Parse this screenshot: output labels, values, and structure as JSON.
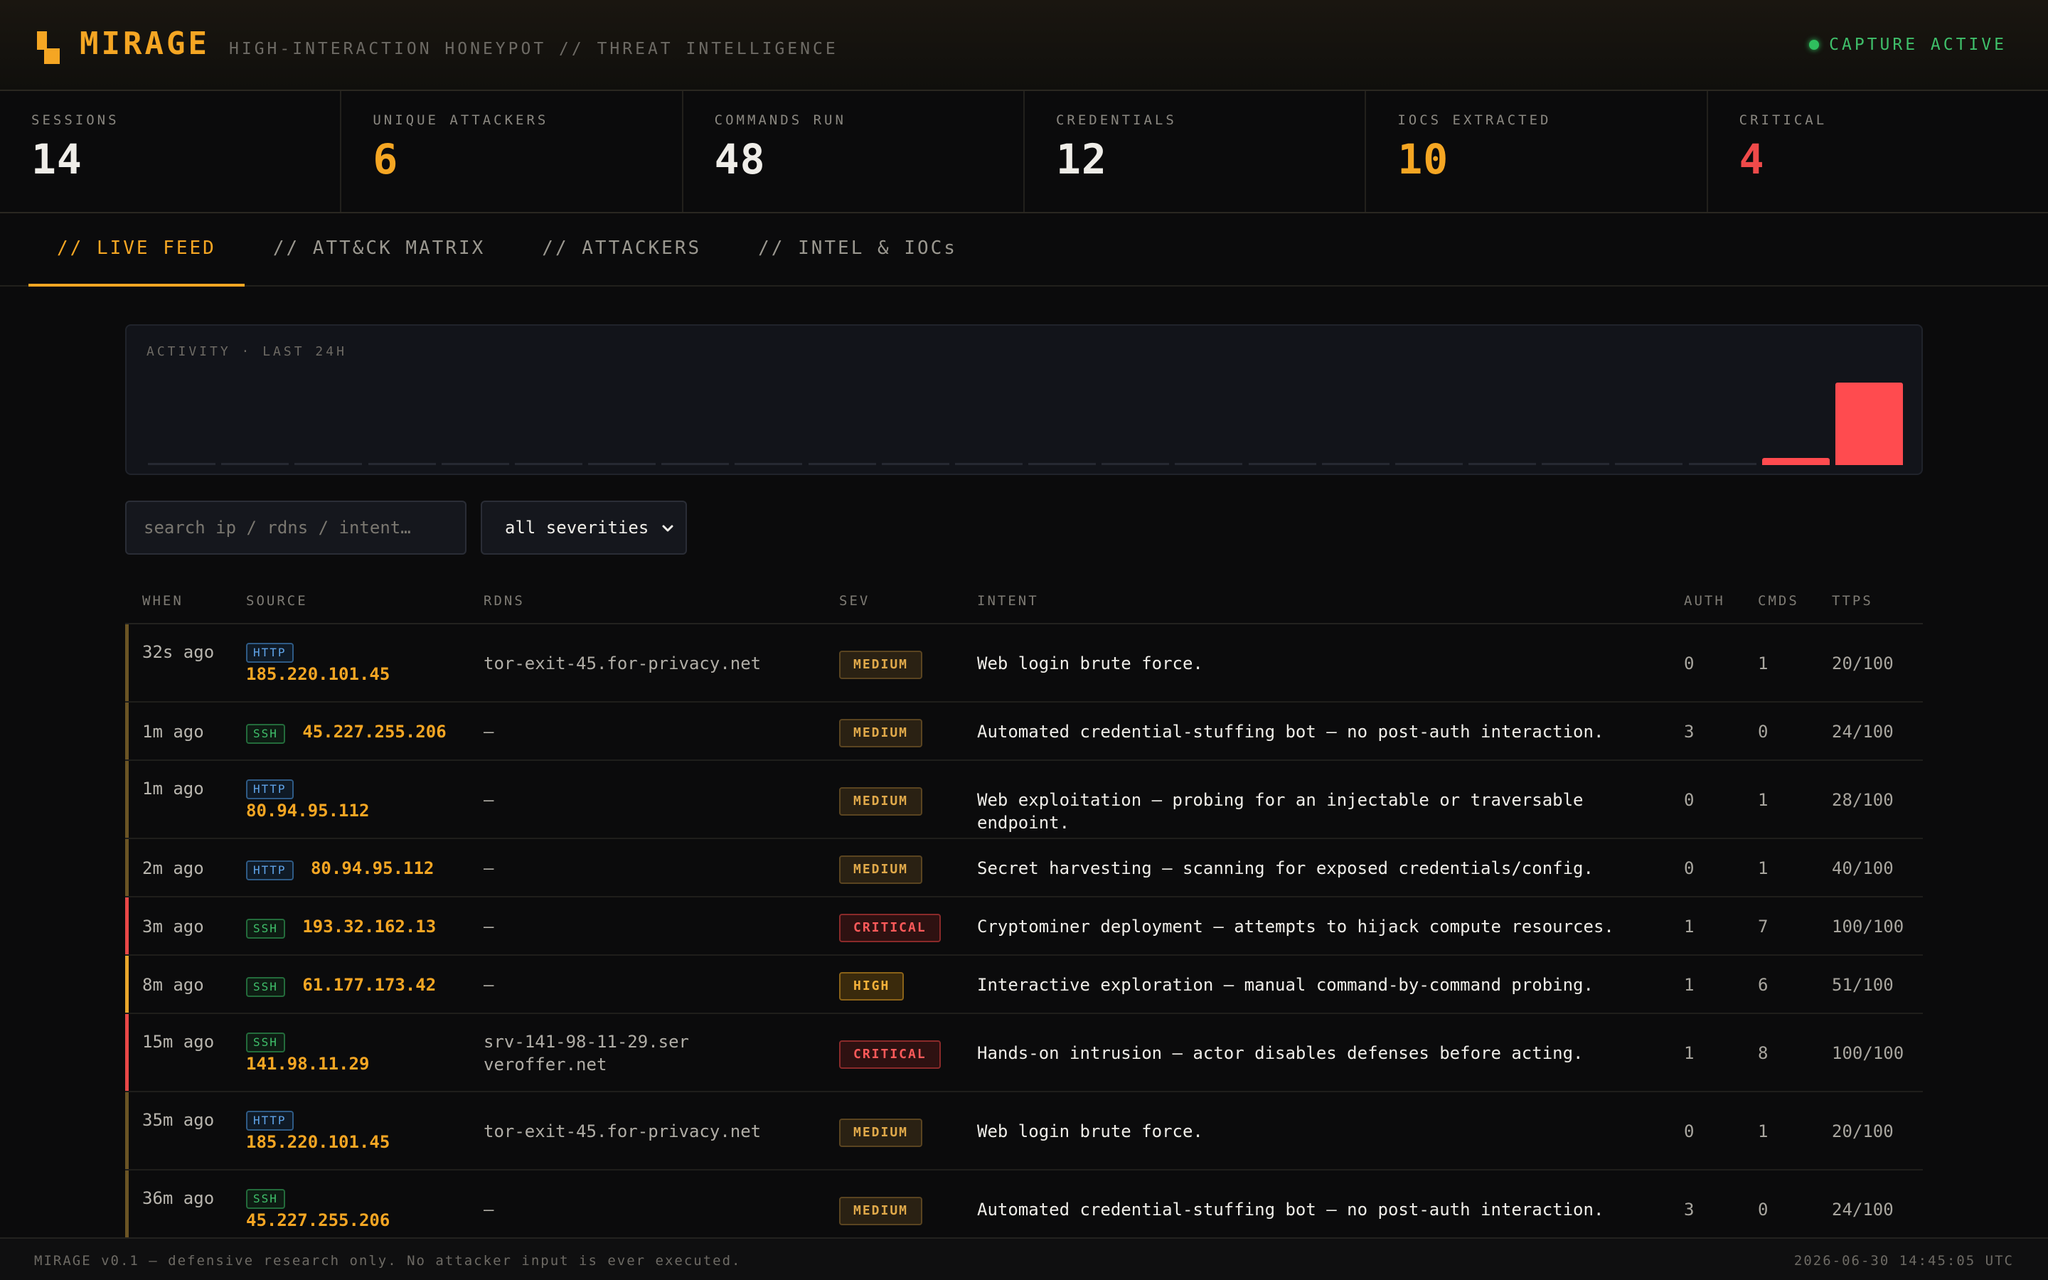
{
  "header": {
    "brand": "MIRAGE",
    "subtitle": "HIGH-INTERACTION HONEYPOT // THREAT INTELLIGENCE",
    "status": "CAPTURE ACTIVE",
    "logo_icon": "mirage-logo-icon",
    "status_icon": "status-dot-icon"
  },
  "stats": [
    {
      "label": "SESSIONS",
      "value": "14",
      "color": "#efede8"
    },
    {
      "label": "UNIQUE ATTACKERS",
      "value": "6",
      "color": "#f5a623"
    },
    {
      "label": "COMMANDS RUN",
      "value": "48",
      "color": "#efede8"
    },
    {
      "label": "CREDENTIALS",
      "value": "12",
      "color": "#efede8"
    },
    {
      "label": "IOCS EXTRACTED",
      "value": "10",
      "color": "#f5a623"
    },
    {
      "label": "CRITICAL",
      "value": "4",
      "color": "#ef4a4a"
    }
  ],
  "tabs": [
    {
      "label": "// LIVE FEED",
      "active": true
    },
    {
      "label": "// ATT&CK MATRIX",
      "active": false
    },
    {
      "label": "// ATTACKERS",
      "active": false
    },
    {
      "label": "// INTEL & IOCs",
      "active": false
    }
  ],
  "activity": {
    "label": "ACTIVITY · LAST 24H",
    "hourly_levels": [
      0,
      0,
      0,
      0,
      0,
      0,
      0,
      0,
      0,
      0,
      0,
      0,
      0,
      0,
      0,
      0,
      0,
      0,
      0,
      0,
      0,
      0,
      1,
      12
    ]
  },
  "filters": {
    "search_placeholder": "search ip / rdns / intent…",
    "severity_selected": "all severities"
  },
  "table": {
    "headers": {
      "when": "WHEN",
      "source": "SOURCE",
      "rdns": "RDNS",
      "sev": "SEV",
      "intent": "INTENT",
      "auth": "AUTH",
      "cmds": "CMDS",
      "ttps": "TTPS"
    },
    "rows": [
      {
        "when": "32s ago",
        "proto": "HTTP",
        "ip": "185.220.101.45",
        "rdns": "tor-exit-45.for-privacy.net",
        "sev": "MEDIUM",
        "intent": "Web login brute force.",
        "auth": "0",
        "cmds": "1",
        "ttps": "20/100"
      },
      {
        "when": "1m ago",
        "proto": "SSH",
        "ip": "45.227.255.206",
        "rdns": "—",
        "sev": "MEDIUM",
        "intent": "Automated credential-stuffing bot — no post-auth interaction.",
        "auth": "3",
        "cmds": "0",
        "ttps": "24/100"
      },
      {
        "when": "1m ago",
        "proto": "HTTP",
        "ip": "80.94.95.112",
        "rdns": "—",
        "sev": "MEDIUM",
        "intent": "Web exploitation — probing for an injectable or traversable endpoint.",
        "auth": "0",
        "cmds": "1",
        "ttps": "28/100"
      },
      {
        "when": "2m ago",
        "proto": "HTTP",
        "ip": "80.94.95.112",
        "rdns": "—",
        "sev": "MEDIUM",
        "intent": "Secret harvesting — scanning for exposed credentials/config.",
        "auth": "0",
        "cmds": "1",
        "ttps": "40/100"
      },
      {
        "when": "3m ago",
        "proto": "SSH",
        "ip": "193.32.162.13",
        "rdns": "—",
        "sev": "CRITICAL",
        "intent": "Cryptominer deployment — attempts to hijack compute resources.",
        "auth": "1",
        "cmds": "7",
        "ttps": "100/100"
      },
      {
        "when": "8m ago",
        "proto": "SSH",
        "ip": "61.177.173.42",
        "rdns": "—",
        "sev": "HIGH",
        "intent": "Interactive exploration — manual command-by-command probing.",
        "auth": "1",
        "cmds": "6",
        "ttps": "51/100"
      },
      {
        "when": "15m ago",
        "proto": "SSH",
        "ip": "141.98.11.29",
        "rdns": "srv-141-98-11-29.serveroffer.net",
        "sev": "CRITICAL",
        "intent": "Hands-on intrusion — actor disables defenses before acting.",
        "auth": "1",
        "cmds": "8",
        "ttps": "100/100"
      },
      {
        "when": "35m ago",
        "proto": "HTTP",
        "ip": "185.220.101.45",
        "rdns": "tor-exit-45.for-privacy.net",
        "sev": "MEDIUM",
        "intent": "Web login brute force.",
        "auth": "0",
        "cmds": "1",
        "ttps": "20/100"
      },
      {
        "when": "36m ago",
        "proto": "SSH",
        "ip": "45.227.255.206",
        "rdns": "—",
        "sev": "MEDIUM",
        "intent": "Automated credential-stuffing bot — no post-auth interaction.",
        "auth": "3",
        "cmds": "0",
        "ttps": "24/100"
      }
    ]
  },
  "footer": {
    "left": "MIRAGE v0.1 — defensive research only. No attacker input is ever executed.",
    "right": "2026-06-30 14:45:05 UTC"
  },
  "colors": {
    "accent": "#f5a623",
    "critical": "#ef4a4a",
    "high": "#f5b23a",
    "medium": "#8a6a2a",
    "ok": "#3fbf6a"
  }
}
